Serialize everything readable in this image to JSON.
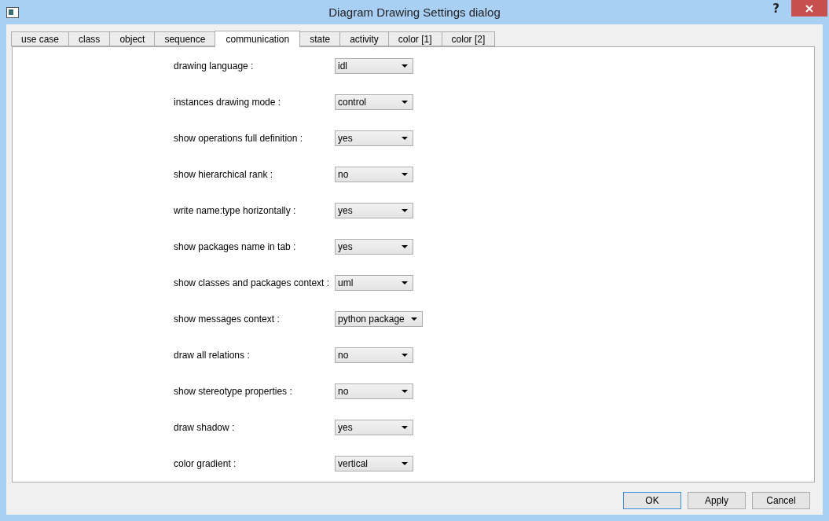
{
  "window": {
    "title": "Diagram Drawing Settings dialog",
    "help": "?"
  },
  "tabs": [
    {
      "label": "use case",
      "selected": false
    },
    {
      "label": "class",
      "selected": false
    },
    {
      "label": "object",
      "selected": false
    },
    {
      "label": "sequence",
      "selected": false
    },
    {
      "label": "communication",
      "selected": true
    },
    {
      "label": "state",
      "selected": false
    },
    {
      "label": "activity",
      "selected": false
    },
    {
      "label": "color [1]",
      "selected": false
    },
    {
      "label": "color [2]",
      "selected": false
    }
  ],
  "settings": [
    {
      "label": "drawing language :",
      "value": "idl"
    },
    {
      "label": "instances drawing mode :",
      "value": "control"
    },
    {
      "label": "show operations full definition :",
      "value": "yes"
    },
    {
      "label": "show hierarchical rank :",
      "value": "no"
    },
    {
      "label": "write name:type horizontally :",
      "value": "yes"
    },
    {
      "label": "show packages name in tab :",
      "value": "yes"
    },
    {
      "label": "show classes and packages context :",
      "value": "uml"
    },
    {
      "label": "show messages context :",
      "value": "python package"
    },
    {
      "label": "draw all relations :",
      "value": "no"
    },
    {
      "label": "show stereotype properties :",
      "value": "no"
    },
    {
      "label": "draw shadow :",
      "value": "yes"
    },
    {
      "label": "color gradient :",
      "value": "vertical"
    }
  ],
  "buttons": [
    {
      "label": "OK",
      "default": true
    },
    {
      "label": "Apply",
      "default": false
    },
    {
      "label": "Cancel",
      "default": false
    }
  ]
}
